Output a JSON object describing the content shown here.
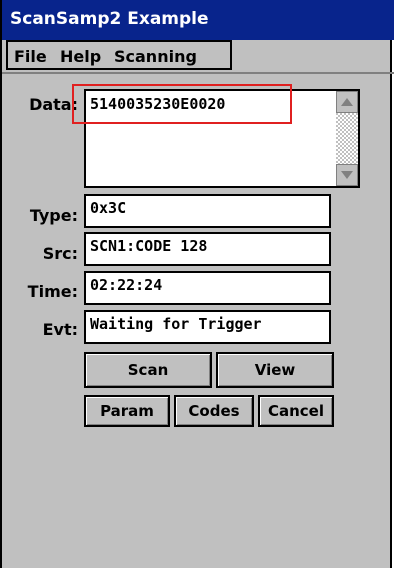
{
  "window": {
    "title": "ScanSamp2 Example"
  },
  "menu": {
    "items": [
      "File",
      "Help",
      "Scanning"
    ]
  },
  "fields": {
    "data": {
      "label": "Data:",
      "value": "5140035230E0020"
    },
    "type": {
      "label": "Type:",
      "value": "0x3C"
    },
    "src": {
      "label": "Src:",
      "value": "SCN1:CODE 128"
    },
    "time": {
      "label": "Time:",
      "value": "02:22:24"
    },
    "evt": {
      "label": "Evt:",
      "value": "Waiting for Trigger"
    }
  },
  "buttons": {
    "scan": "Scan",
    "view": "View",
    "param": "Param",
    "codes": "Codes",
    "cancel": "Cancel"
  },
  "colors": {
    "titlebar": "#08248c",
    "window": "#c0c0c0",
    "highlight": "#e02020"
  }
}
